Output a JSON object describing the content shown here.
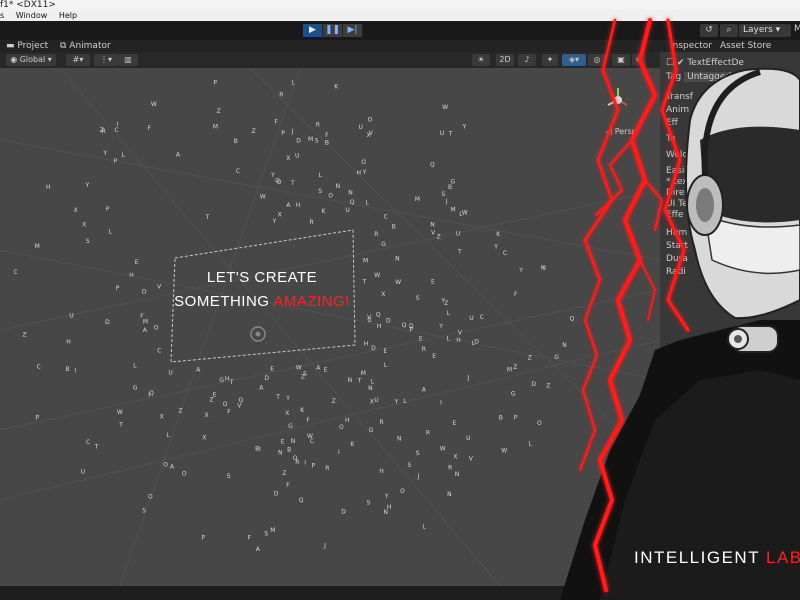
{
  "window": {
    "title": "f1* <DX11>"
  },
  "menu": {
    "items": [
      "s",
      "Window",
      "Help"
    ]
  },
  "toolbar": {
    "layers_label": "Layers",
    "m_label": "M"
  },
  "tabs": {
    "project": "Project",
    "animator": "Animator",
    "inspector": "Inspector",
    "asset_store": "Asset Store Uploader"
  },
  "scene_toolbar": {
    "global_label": "Global",
    "mode_2d": "2D",
    "persp_label": "Persp"
  },
  "scene": {
    "line1": "LET'S CREATE",
    "line2_white": "SOMETHING ",
    "line2_red": "AMAZING!"
  },
  "inspector": {
    "object_name": "TextEffectDe",
    "tag_label": "Tag",
    "tag_value": "Untagged",
    "components": [
      "Transf",
      "Anim",
      "Eff",
      "Te"
    ],
    "rows": [
      "Welcome",
      "Easily c",
      "* text a",
      "Directi",
      "UI Te",
      "Effe",
      "Hum",
      "Start",
      "Dura",
      "Radi"
    ]
  },
  "brand": {
    "white": "INTELLIGENT ",
    "red": "LABS"
  },
  "colors": {
    "accent_red": "#ff1a1a",
    "scene_bg": "#474747",
    "play_active": "#1f4f87"
  }
}
